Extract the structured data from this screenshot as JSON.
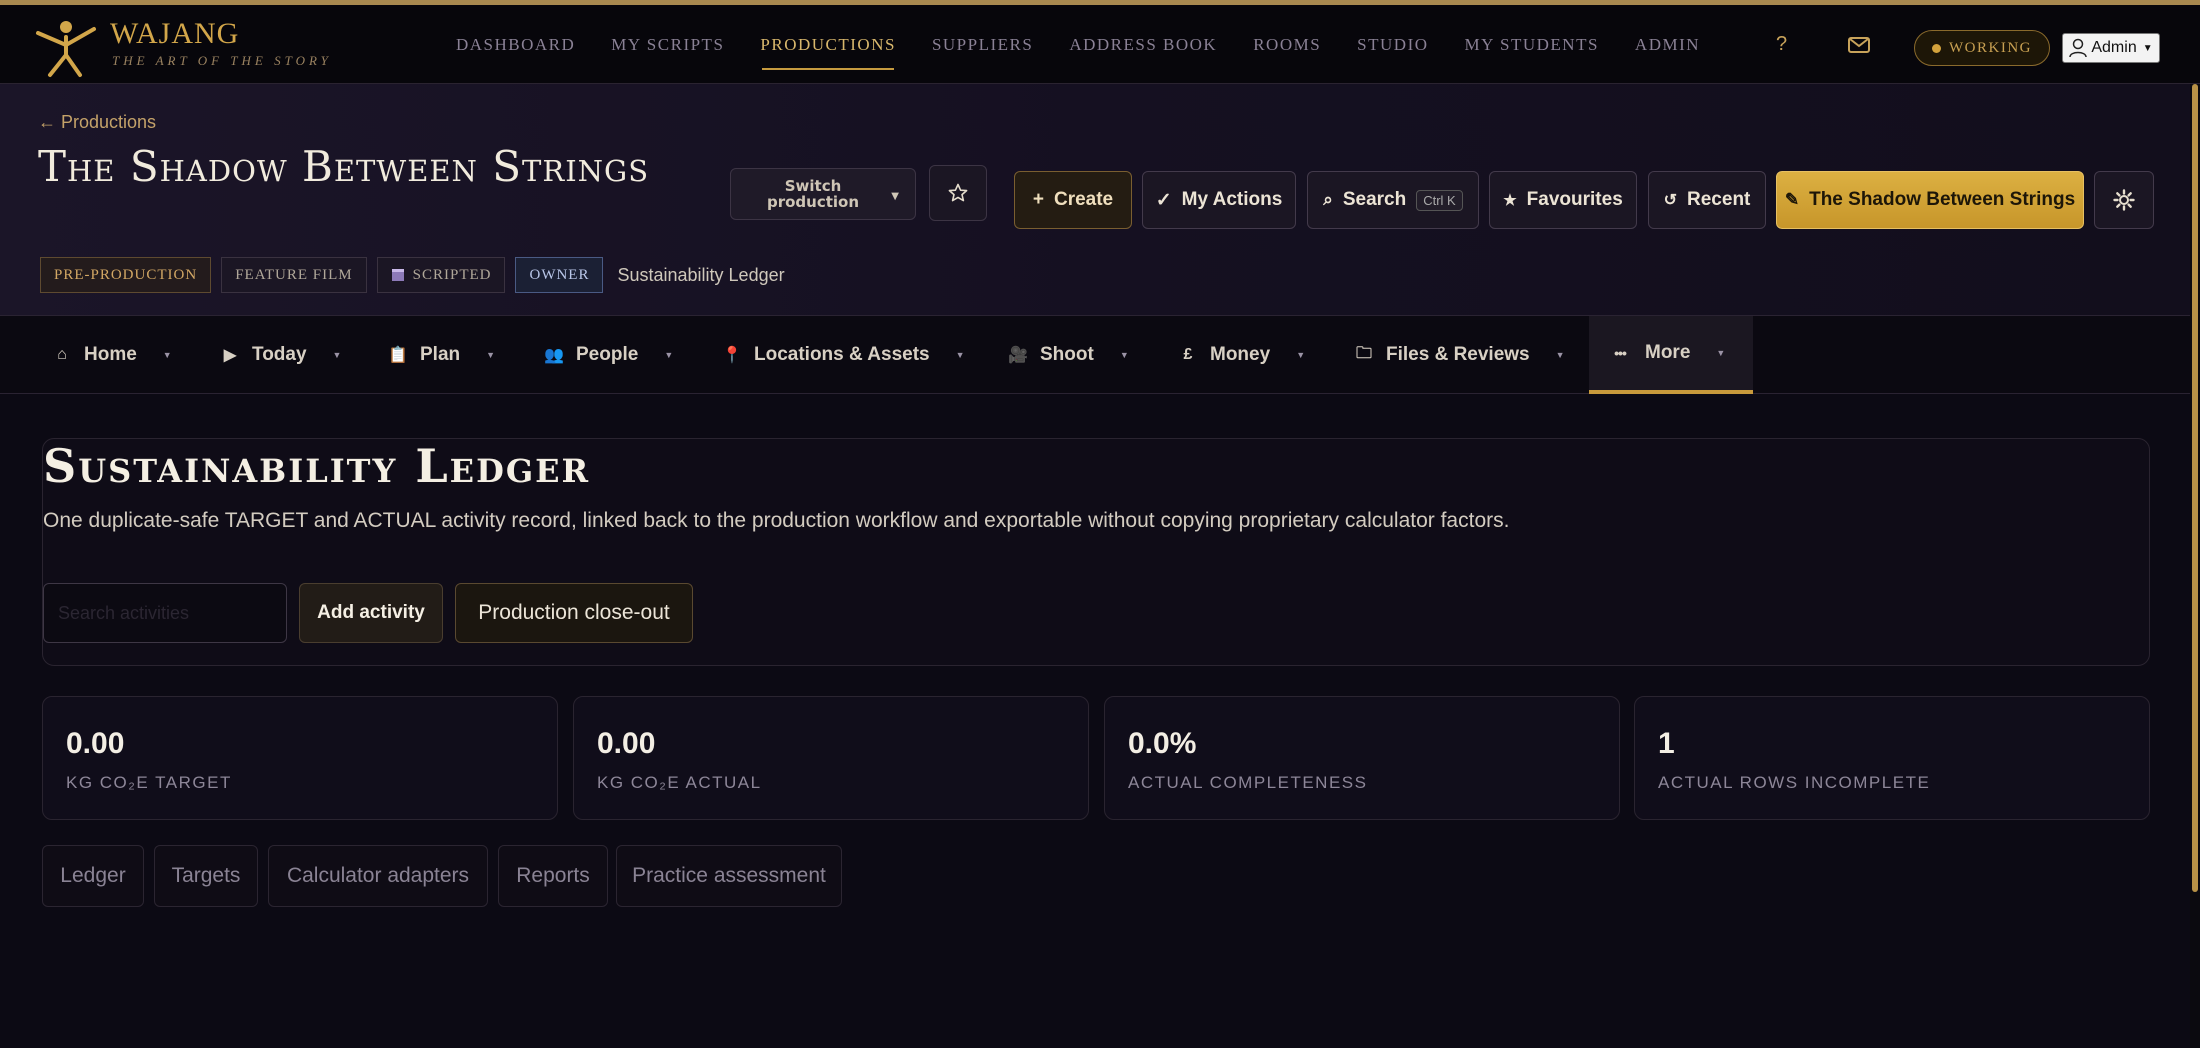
{
  "brand": {
    "name": "WAJANG",
    "tagline": "THE ART OF THE STORY"
  },
  "top_nav": [
    {
      "label": "DASHBOARD",
      "active": false
    },
    {
      "label": "MY SCRIPTS",
      "active": false
    },
    {
      "label": "PRODUCTIONS",
      "active": true
    },
    {
      "label": "SUPPLIERS",
      "active": false
    },
    {
      "label": "ADDRESS BOOK",
      "active": false
    },
    {
      "label": "ROOMS",
      "active": false
    },
    {
      "label": "STUDIO",
      "active": false
    },
    {
      "label": "MY STUDENTS",
      "active": false
    },
    {
      "label": "ADMIN",
      "active": false
    }
  ],
  "top_right": {
    "help": "?",
    "status": "WORKING",
    "user": "Admin"
  },
  "production": {
    "back_link": "← Productions",
    "title": "The Shadow Between Strings",
    "tags": [
      "PRE-PRODUCTION",
      "FEATURE FILM",
      "SCRIPTED",
      "OWNER"
    ],
    "current_page": "Sustainability Ledger",
    "switch_label": "Switch production"
  },
  "actions": {
    "create": "Create",
    "my_actions": "My Actions",
    "search": "Search",
    "search_shortcut": "Ctrl K",
    "favourites": "Favourites",
    "recent": "Recent",
    "current_production": "The Shadow Between Strings"
  },
  "section_nav": [
    {
      "label": "Home",
      "icon": "home-icon",
      "glyph": "⌂"
    },
    {
      "label": "Today",
      "icon": "play-icon",
      "glyph": "▶"
    },
    {
      "label": "Plan",
      "icon": "clipboard-icon",
      "glyph": "📋"
    },
    {
      "label": "People",
      "icon": "people-icon",
      "glyph": "👥"
    },
    {
      "label": "Locations & Assets",
      "icon": "pin-icon",
      "glyph": "📍"
    },
    {
      "label": "Shoot",
      "icon": "camera-crew-icon",
      "glyph": "🎥"
    },
    {
      "label": "Money",
      "icon": "pound-icon",
      "glyph": "£"
    },
    {
      "label": "Files & Reviews",
      "icon": "folder-icon",
      "glyph": "🗀"
    },
    {
      "label": "More",
      "icon": "more-icon",
      "glyph": "•••"
    }
  ],
  "ledger": {
    "title": "Sustainability Ledger",
    "description": "One duplicate-safe TARGET and ACTUAL activity record, linked back to the production workflow and exportable without copying proprietary calculator factors.",
    "input_placeholder": "Search activities",
    "add_button": "Add activity",
    "closeout_button": "Production close-out"
  },
  "stats": [
    {
      "value": "0.00",
      "label": "KG CO₂E TARGET"
    },
    {
      "value": "0.00",
      "label": "KG CO₂E ACTUAL"
    },
    {
      "value": "0.0%",
      "label": "ACTUAL COMPLETENESS"
    },
    {
      "value": "1",
      "label": "ACTUAL ROWS INCOMPLETE"
    }
  ],
  "subtabs": [
    "Ledger",
    "Targets",
    "Calculator adapters",
    "Reports",
    "Practice assessment"
  ],
  "colors": {
    "accent": "#c89a3c",
    "background": "#0c0a14",
    "primary_button": "#d4a637"
  }
}
